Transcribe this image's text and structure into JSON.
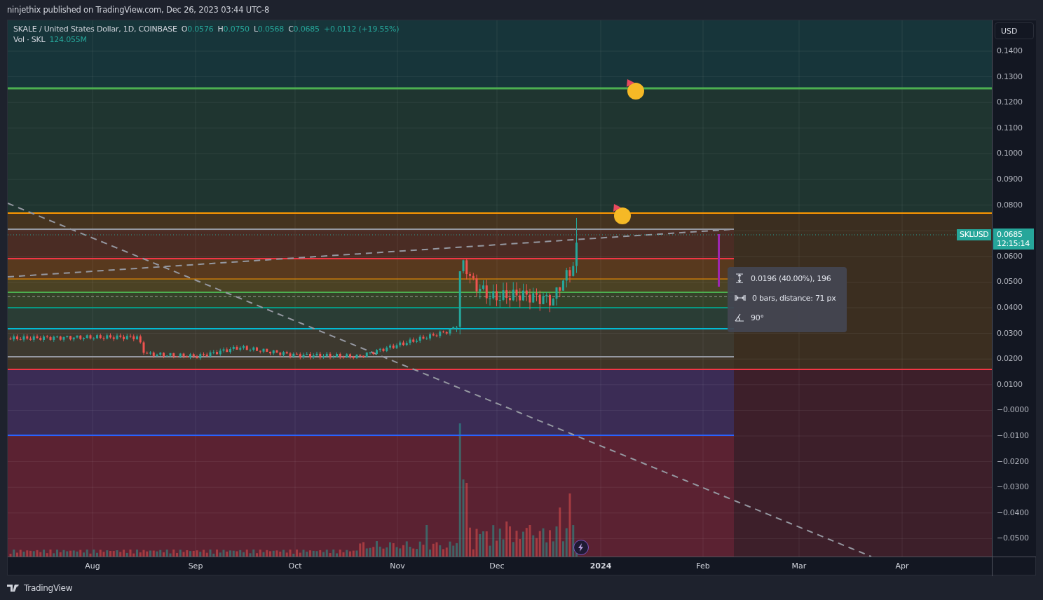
{
  "header": {
    "publisher": "ninjethix published on TradingView.com, Dec 26, 2023 03:44 UTC-8"
  },
  "legend": {
    "title": "SKALE / United States Dollar, 1D, COINBASE",
    "ohlc": [
      {
        "label": "O",
        "value": "0.0576"
      },
      {
        "label": "H",
        "value": "0.0750"
      },
      {
        "label": "L",
        "value": "0.0568"
      },
      {
        "label": "C",
        "value": "0.0685"
      }
    ],
    "change": "+0.0112 (+19.55%)",
    "volume": {
      "label": "Vol · SKL",
      "value": "124.055M"
    }
  },
  "price_axis": {
    "currency": "USD",
    "ticks": [
      "0.1400",
      "0.1300",
      "0.1200",
      "0.1100",
      "0.1000",
      "0.0900",
      "0.0800",
      "0.0600",
      "0.0500",
      "0.0400",
      "0.0300",
      "0.0200",
      "0.0100",
      "−0.0000",
      "−0.0100",
      "−0.0200",
      "−0.0300",
      "−0.0400",
      "−0.0500"
    ]
  },
  "symbol_tag": "SKLUSD",
  "last_price": {
    "value": "0.0685",
    "countdown": "12:15:14"
  },
  "measure_tooltip": [
    {
      "kind": "price",
      "text": "0.0196 (40.00%), 196"
    },
    {
      "kind": "bars",
      "text": "0 bars, distance: 71 px"
    },
    {
      "kind": "angle",
      "text": "90°"
    }
  ],
  "time_axis": [
    {
      "label": "Aug",
      "bold": false
    },
    {
      "label": "Sep",
      "bold": false
    },
    {
      "label": "Oct",
      "bold": false
    },
    {
      "label": "Nov",
      "bold": false
    },
    {
      "label": "Dec",
      "bold": false
    },
    {
      "label": "2024",
      "bold": true
    },
    {
      "label": "Feb",
      "bold": false
    },
    {
      "label": "Mar",
      "bold": false
    },
    {
      "label": "Apr",
      "bold": false
    }
  ],
  "footer": {
    "brand": "TradingView"
  }
}
